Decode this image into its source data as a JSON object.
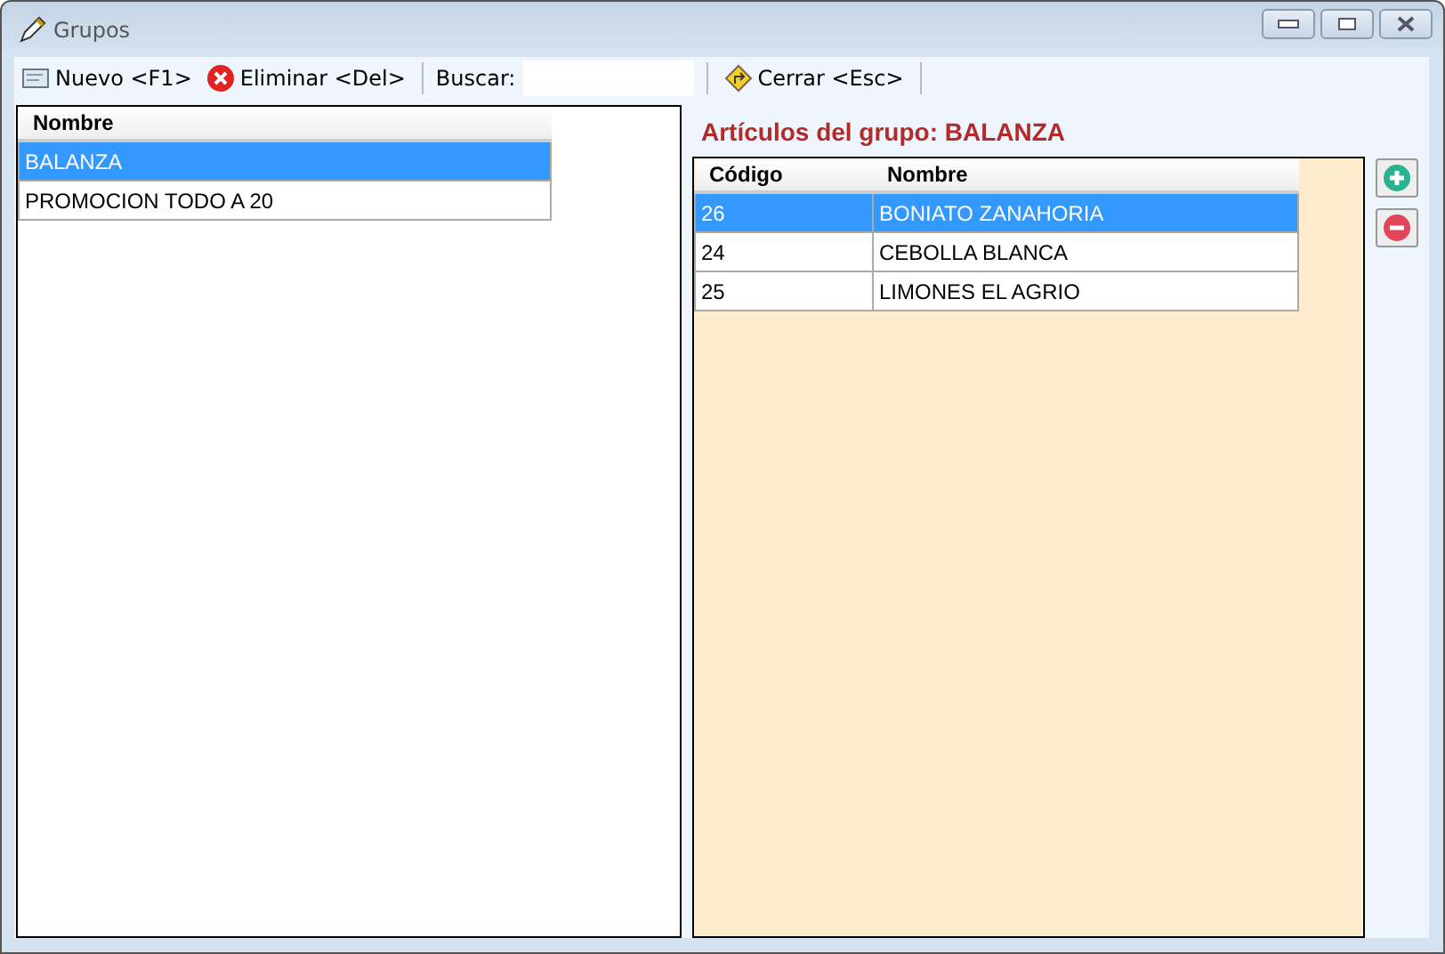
{
  "window": {
    "title": "Grupos"
  },
  "toolbar": {
    "new_button": "Nuevo <F1>",
    "delete_button": "Eliminar <Del>",
    "search_label": "Buscar:",
    "close_button": "Cerrar <Esc>"
  },
  "groups_table": {
    "columns": [
      "Nombre"
    ],
    "rows": [
      {
        "cells": [
          "BALANZA"
        ],
        "selected": true
      },
      {
        "cells": [
          "PROMOCION TODO A 20"
        ],
        "selected": false
      }
    ]
  },
  "items_title": "Artículos del grupo: BALANZA",
  "items_table": {
    "columns": [
      "Código",
      "Nombre"
    ],
    "rows": [
      {
        "cells": [
          "26",
          "BONIATO ZANAHORIA"
        ],
        "selected": true
      },
      {
        "cells": [
          "24",
          "CEBOLLA BLANCA"
        ],
        "selected": false
      },
      {
        "cells": [
          "25",
          "LIMONES EL AGRIO"
        ],
        "selected": false
      }
    ]
  }
}
